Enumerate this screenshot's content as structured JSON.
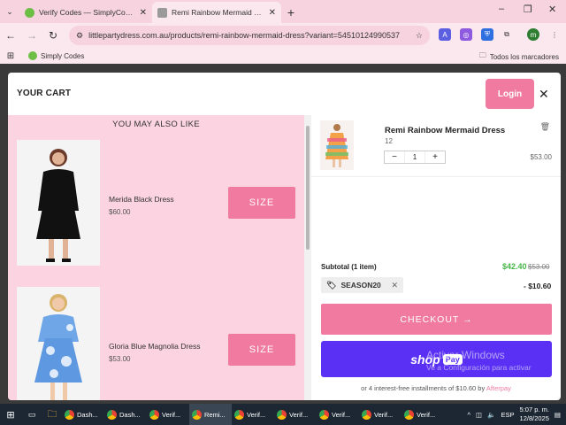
{
  "browser": {
    "tabs": [
      {
        "title": "Verify Codes — SimplyCodes",
        "active": false,
        "favicon_color": "#6cbe45"
      },
      {
        "title": "Remi Rainbow Mermaid Dress | Li",
        "active": true,
        "favicon_color": "#7a7a7a"
      }
    ],
    "url": "littlepartydress.com.au/products/remi-rainbow-mermaid-dress?variant=54510124990537",
    "bookmarks": [
      {
        "label": "Simply Codes"
      }
    ],
    "all_bookmarks": "Todos los marcadores",
    "profile_initial": "m"
  },
  "cart": {
    "title": "YOUR CART",
    "login_label": "Login",
    "upsell_title": "YOU MAY ALSO LIKE",
    "upsell_products": [
      {
        "name": "Merida Black Dress",
        "price": "$60.00",
        "size_label": "SIZE"
      },
      {
        "name": "Gloria Blue Magnolia Dress",
        "price": "$53.00",
        "size_label": "SIZE"
      }
    ],
    "line_item": {
      "name": "Remi Rainbow Mermaid Dress",
      "variant": "12",
      "quantity": "1",
      "price": "$53.00"
    },
    "subtotal_label": "Subtotal (1 item)",
    "subtotal_new": "$42.40",
    "subtotal_old": "$53.00",
    "coupon_code": "SEASON20",
    "discount": "- $10.60",
    "checkout_label": "CHECKOUT →",
    "shoppay_shop": "shop",
    "shoppay_pay": "Pay",
    "afterpay_text": "or 4 interest-free installments of $10.60 by",
    "afterpay_brand": "Afterpay"
  },
  "watermark": {
    "title": "Activar Windows",
    "subtitle": "Ve a Configuración para activar",
    "subtitle2": "Windows."
  },
  "taskbar": {
    "items": [
      {
        "label": "Dash...",
        "active": false
      },
      {
        "label": "Dash...",
        "active": false
      },
      {
        "label": "Verif...",
        "active": false
      },
      {
        "label": "Remi...",
        "active": true
      },
      {
        "label": "Verif...",
        "active": false
      },
      {
        "label": "Verif...",
        "active": false
      },
      {
        "label": "Verif...",
        "active": false
      },
      {
        "label": "Verif...",
        "active": false
      },
      {
        "label": "Verif...",
        "active": false
      }
    ],
    "lang": "ESP",
    "time": "5:07 p. m.",
    "date": "12/8/2025"
  },
  "colors": {
    "brand_pink": "#f07aa0",
    "shoppay_purple": "#5a31f4",
    "discount_green": "#46b548"
  }
}
